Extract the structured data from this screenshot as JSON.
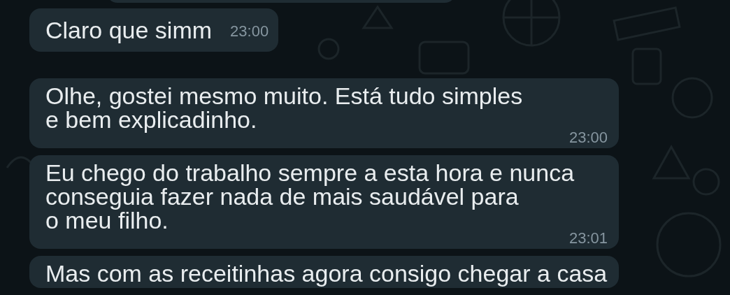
{
  "messages": [
    {
      "kind": "inline",
      "lines": [
        "Claro que simm"
      ],
      "time": "23:00"
    },
    {
      "kind": "block",
      "lines": [
        "Olhe, gostei mesmo muito. Está tudo simples",
        "e bem explicadinho."
      ],
      "time": "23:00"
    },
    {
      "kind": "block",
      "lines": [
        "Eu chego do trabalho sempre a esta hora e nunca",
        "conseguia fazer nada de mais saudável para",
        "o meu filho."
      ],
      "time": "23:01"
    },
    {
      "kind": "block",
      "lines": [
        "Mas com as receitinhas agora consigo chegar a casa"
      ]
    }
  ]
}
